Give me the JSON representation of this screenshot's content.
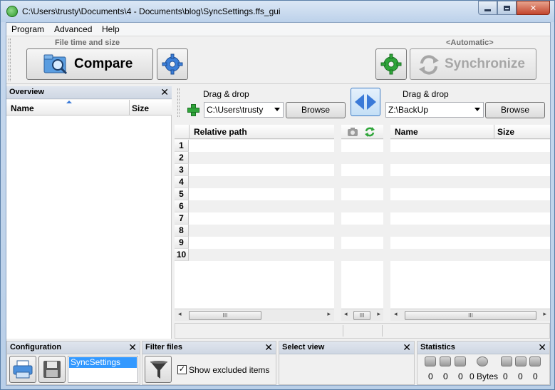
{
  "window": {
    "title": "C:\\Users\\trusty\\Documents\\4 - Documents\\blog\\SyncSettings.ffs_gui"
  },
  "menu": {
    "items": [
      "Program",
      "Advanced",
      "Help"
    ]
  },
  "toolbar": {
    "compare_caption": "File time and size",
    "compare_label": "Compare",
    "sync_caption": "<Automatic>",
    "sync_label": "Synchronize"
  },
  "overview": {
    "title": "Overview",
    "col_name": "Name",
    "col_size": "Size"
  },
  "left_folder": {
    "drag_label": "Drag & drop",
    "path": "C:\\Users\\trusty",
    "browse_label": "Browse"
  },
  "right_folder": {
    "drag_label": "Drag & drop",
    "path": "Z:\\BackUp",
    "browse_label": "Browse"
  },
  "left_grid": {
    "col_relative_path": "Relative path",
    "rows": [
      "1",
      "2",
      "3",
      "4",
      "5",
      "6",
      "7",
      "8",
      "9",
      "10"
    ]
  },
  "right_grid": {
    "col_name": "Name",
    "col_size": "Size"
  },
  "configuration": {
    "title": "Configuration",
    "selected": "SyncSettings"
  },
  "filter": {
    "title": "Filter files",
    "show_excluded_label": "Show excluded items",
    "show_excluded_checked": true
  },
  "select_view": {
    "title": "Select view"
  },
  "statistics": {
    "title": "Statistics",
    "values": [
      "0",
      "0",
      "0",
      "0 Bytes",
      "0",
      "0",
      "0"
    ]
  },
  "colors": {
    "title_bar": "#c8d9ee",
    "green_icon": "#2fa53a",
    "blue_accent": "#3a7ad8",
    "close_button": "#c3452d",
    "selection": "#3399ff"
  }
}
